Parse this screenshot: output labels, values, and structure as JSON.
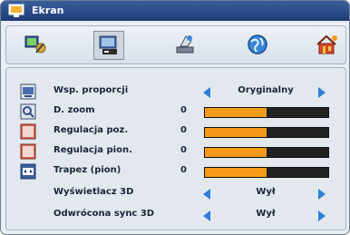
{
  "window": {
    "title": "Ekran"
  },
  "tabs": [
    {
      "icon": "image-settings-icon"
    },
    {
      "icon": "display-screen-icon",
      "selected": true
    },
    {
      "icon": "setup-icon"
    },
    {
      "icon": "globe-icon"
    },
    {
      "icon": "options-home-icon"
    }
  ],
  "menu": {
    "aspect_ratio": {
      "label": "Wsp. proporcji",
      "value": "Oryginalny"
    },
    "digital_zoom": {
      "label": "D. zoom",
      "value": "0",
      "level": 0.5
    },
    "h_position": {
      "label": "Regulacja poz.",
      "value": "0",
      "level": 0.5
    },
    "v_position": {
      "label": "Regulacja pion.",
      "value": "0",
      "level": 0.5
    },
    "keystone": {
      "label": "Trapez (pion)",
      "value": "0",
      "level": 0.5
    },
    "display_3d": {
      "label": "Wyświetlacz 3D",
      "value": "Wył"
    },
    "inverted_sync_3d": {
      "label": "Odwrócona sync 3D",
      "value": "Wył"
    }
  },
  "colors": {
    "accent_blue": "#2d7fd8",
    "slider_fill": "#f59a1b",
    "title_bar": "#1d3c76"
  }
}
